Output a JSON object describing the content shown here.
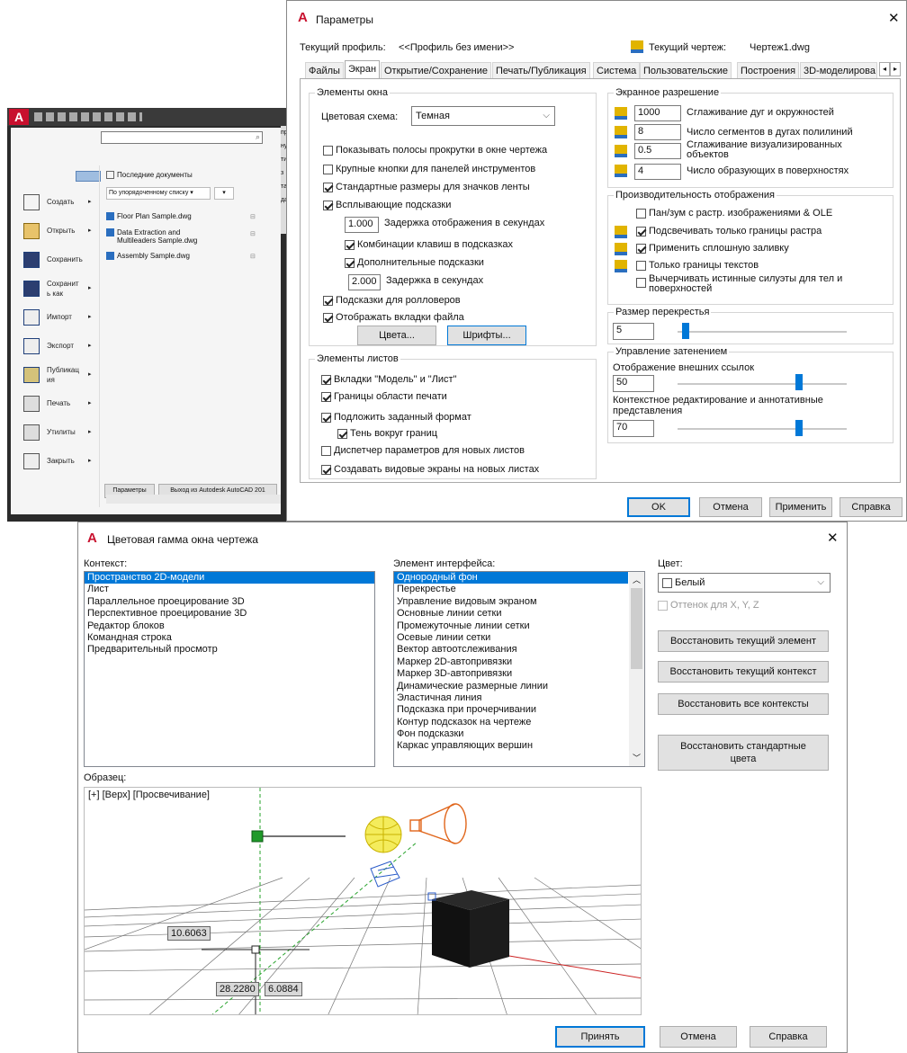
{
  "app_menu": {
    "title_chars": "A",
    "search_placeholder": "",
    "recent_title": "Последние документы",
    "sort_label": "По упорядоченному списку",
    "items": [
      {
        "label": "Создать",
        "icon": "new-icon"
      },
      {
        "label": "Открыть",
        "icon": "open-icon"
      },
      {
        "label": "Сохранить",
        "icon": "save-icon"
      },
      {
        "label": "Сохранит ь как",
        "icon": "saveas-icon"
      },
      {
        "label": "Импорт",
        "icon": "import-icon"
      },
      {
        "label": "Экспорт",
        "icon": "export-icon"
      },
      {
        "label": "Публикац ия",
        "icon": "publish-icon"
      },
      {
        "label": "Печать",
        "icon": "print-icon"
      },
      {
        "label": "Утилиты",
        "icon": "utilities-icon"
      },
      {
        "label": "Закрыть",
        "icon": "close-doc-icon"
      }
    ],
    "recent_docs": [
      "Floor Plan Sample.dwg",
      "Data Extraction and Multileaders Sample.dwg",
      "Assembly Sample.dwg"
    ],
    "side_fragments": [
      "прав",
      "нуть",
      "тия з",
      "таб",
      "дакти"
    ],
    "options_btn": "Параметры",
    "exit_btn": "Выход из Autodesk AutoCAD 201"
  },
  "options_dialog": {
    "title": "Параметры",
    "profile_label": "Текущий профиль:",
    "profile_value": "<<Профиль без имени>>",
    "drawing_label": "Текущий чертеж:",
    "drawing_value": "Чертеж1.dwg",
    "tabs": [
      "Файлы",
      "Экран",
      "Открытие/Сохранение",
      "Печать/Публикация",
      "Система",
      "Пользовательские",
      "Построения",
      "3D-моделирова"
    ],
    "active_tab": 1,
    "window_elements": {
      "title": "Элементы окна",
      "scheme_label": "Цветовая схема:",
      "scheme_value": "Темная",
      "checks": [
        {
          "label": "Показывать полосы прокрутки в окне чертежа",
          "on": false
        },
        {
          "label": "Крупные кнопки для панелей инструментов",
          "on": false
        },
        {
          "label": "Стандартные размеры для значков ленты",
          "on": true
        },
        {
          "label": "Всплывающие подсказки",
          "on": true
        }
      ],
      "tooltip_delay_value": "1.000",
      "tooltip_delay_label": "Задержка отображения в секундах",
      "sub_checks": [
        {
          "label": "Комбинации клавиш в подсказках",
          "on": true
        },
        {
          "label": "Дополнительные подсказки",
          "on": true
        }
      ],
      "ext_delay_value": "2.000",
      "ext_delay_label": "Задержка в секундах",
      "checks2": [
        {
          "label": "Подсказки для ролловеров",
          "on": true
        },
        {
          "label": "Отображать вкладки файла",
          "on": true
        }
      ],
      "colors_btn": "Цвета...",
      "fonts_btn": "Шрифты..."
    },
    "layout_elements": {
      "title": "Элементы листов",
      "checks": [
        {
          "label": "Вкладки \"Модель\" и \"Лист\"",
          "on": true
        },
        {
          "label": "Границы области печати",
          "on": true
        },
        {
          "label": "Подложить заданный формат",
          "on": true
        },
        {
          "label": "Тень вокруг границ",
          "on": true
        },
        {
          "label": "Диспетчер параметров для новых листов",
          "on": false
        },
        {
          "label": "Создавать видовые экраны на новых листах",
          "on": true
        }
      ]
    },
    "resolution": {
      "title": "Экранное разрешение",
      "rows": [
        {
          "value": "1000",
          "label": "Сглаживание дуг и окружностей"
        },
        {
          "value": "8",
          "label": "Число сегментов в дугах полилиний"
        },
        {
          "value": "0.5",
          "label": "Сглаживание визуализированных объектов"
        },
        {
          "value": "4",
          "label": "Число образующих в поверхностях"
        }
      ]
    },
    "performance": {
      "title": "Производительность отображения",
      "checks": [
        {
          "label": "Пан/зум с растр. изображениями & OLE",
          "on": false
        },
        {
          "label": "Подсвечивать только границы растра",
          "on": true
        },
        {
          "label": "Применить сплошную заливку",
          "on": true
        },
        {
          "label": "Только границы текстов",
          "on": false
        },
        {
          "label": "Вычерчивать истинные силуэты для тел и поверхностей",
          "on": false
        }
      ]
    },
    "crosshair": {
      "title": "Размер перекрестья",
      "value": "5",
      "level": 0.05
    },
    "fade": {
      "title": "Управление затенением",
      "xref_label": "Отображение внешних ссылок",
      "xref_value": "50",
      "xref_level": 0.72,
      "inplace_label": "Контекстное редактирование и аннотативные представления",
      "inplace_value": "70",
      "inplace_level": 0.72
    },
    "buttons": [
      "OK",
      "Отмена",
      "Применить",
      "Справка"
    ]
  },
  "color_dialog": {
    "title": "Цветовая гамма окна чертежа",
    "context_label": "Контекст:",
    "contexts": [
      "Пространство 2D-модели",
      "Лист",
      "Параллельное проецирование 3D",
      "Перспективное проецирование 3D",
      "Редактор блоков",
      "Командная строка",
      "Предварительный просмотр"
    ],
    "element_label": "Элемент интерфейса:",
    "elements": [
      "Однородный фон",
      "Перекрестье",
      "Управление видовым экраном",
      "Основные линии сетки",
      "Промежуточные линии сетки",
      "Осевые линии сетки",
      "Вектор автоотслеживания",
      "Маркер 2D-автопривязки",
      "Маркер 3D-автопривязки",
      "Динамические размерные линии",
      "Эластичная линия",
      "Подсказка при прочерчивании",
      "Контур подсказок на чертеже",
      "Фон подсказки",
      "Каркас управляющих вершин"
    ],
    "color_label": "Цвет:",
    "color_value": "Белый",
    "tint_label": "Оттенок для X, Y, Z",
    "restore_buttons": [
      "Восстановить текущий элемент",
      "Восстановить текущий контекст",
      "Восстановить все контексты",
      "Восстановить стандартные цвета"
    ],
    "sample_label": "Образец:",
    "viewport_label": "[+] [Верх] [Просвечивание]",
    "dim_values": [
      "10.6063",
      "28.2280",
      "6.0884"
    ],
    "buttons": [
      "Принять",
      "Отмена",
      "Справка"
    ]
  },
  "colors": {
    "accent": "#0078d7",
    "autocad_red": "#c8102e",
    "dark_bg": "#2b2b2b"
  }
}
